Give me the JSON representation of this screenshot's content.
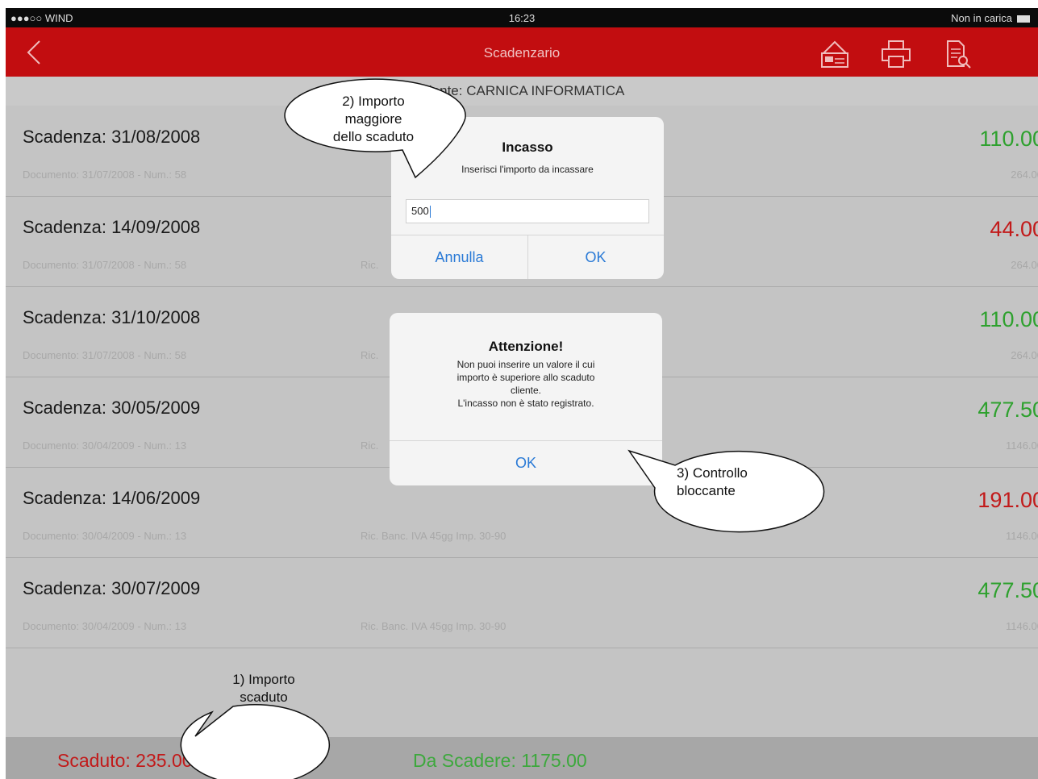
{
  "status_bar": {
    "carrier": "●●●○○ WIND",
    "time": "16:23",
    "battery_text": "Non in carica"
  },
  "nav": {
    "title": "Scadenzario"
  },
  "subheader": {
    "customer": "cliente: CARNICA  INFORMATICA"
  },
  "rows": [
    {
      "due_date": "Scadenza: 31/08/2008",
      "document": "Documento: 31/07/2008 - Num.: 58",
      "payment_terms": "",
      "amount": "110.00",
      "amount_color": "#2ea12e",
      "doc_total": "264.00"
    },
    {
      "due_date": "Scadenza: 14/09/2008",
      "document": "Documento: 31/07/2008 - Num.: 58",
      "payment_terms": "Ric.",
      "amount": "44.00",
      "amount_color": "#c21a1a",
      "doc_total": "264.00"
    },
    {
      "due_date": "Scadenza: 31/10/2008",
      "document": "Documento: 31/07/2008 - Num.: 58",
      "payment_terms": "Ric.",
      "amount": "110.00",
      "amount_color": "#2ea12e",
      "doc_total": "264.00"
    },
    {
      "due_date": "Scadenza: 30/05/2009",
      "document": "Documento: 30/04/2009 - Num.: 13",
      "payment_terms": "Ric.",
      "amount": "477.50",
      "amount_color": "#2ea12e",
      "doc_total": "1146.00"
    },
    {
      "due_date": "Scadenza: 14/06/2009",
      "document": "Documento: 30/04/2009 - Num.: 13",
      "payment_terms": "Ric. Banc. IVA 45gg Imp. 30-90",
      "amount": "191.00",
      "amount_color": "#c21a1a",
      "doc_total": "1146.00"
    },
    {
      "due_date": "Scadenza: 30/07/2009",
      "document": "Documento: 30/04/2009 - Num.: 13",
      "payment_terms": "Ric. Banc. IVA 45gg Imp. 30-90",
      "amount": "477.50",
      "amount_color": "#2ea12e",
      "doc_total": "1146.00"
    }
  ],
  "footer": {
    "overdue": "Scaduto: 235.00",
    "upcoming": "Da Scadere: 1175.00"
  },
  "incasso_dialog": {
    "title": "Incasso",
    "message": "Inserisci l'importo da incassare",
    "input_value": "500",
    "cancel_label": "Annulla",
    "ok_label": "OK"
  },
  "alert_dialog": {
    "title": "Attenzione!",
    "line1": "Non puoi inserire un valore il cui",
    "line2": "importo è superiore allo scaduto",
    "line3": "cliente.",
    "line4": "L'incasso non è stato registrato.",
    "ok_label": "OK"
  },
  "callouts": {
    "c1_line1": "1) Importo",
    "c1_line2": "scaduto",
    "c2_line1": "2) Importo",
    "c2_line2": "maggiore",
    "c2_line3": "dello scaduto",
    "c3_line1": "3)  Controllo",
    "c3_line2": "bloccante"
  },
  "icons": [
    "back-chevron-icon",
    "house-card-icon",
    "printer-icon",
    "document-search-icon"
  ]
}
